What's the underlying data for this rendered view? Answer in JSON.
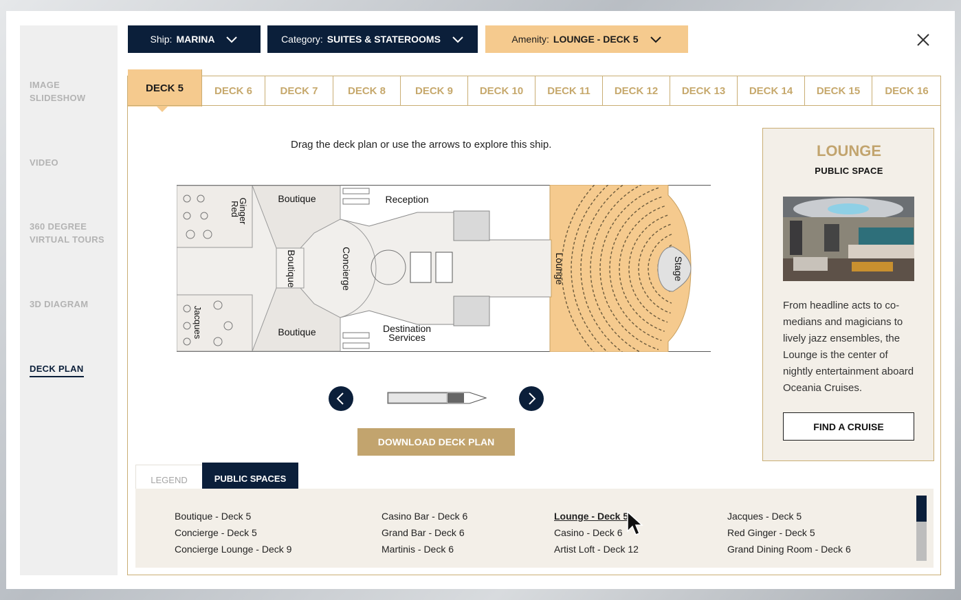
{
  "sidebar": {
    "items": [
      {
        "label": "IMAGE SLIDESHOW"
      },
      {
        "label": "VIDEO"
      },
      {
        "label": "360 DEGREE VIRTUAL TOURS"
      },
      {
        "label": "3D DIAGRAM"
      },
      {
        "label": "DECK PLAN"
      }
    ]
  },
  "filters": {
    "ship": {
      "prefix": "Ship:",
      "value": "MARINA"
    },
    "category": {
      "prefix": "Category:",
      "value": "SUITES & STATEROOMS"
    },
    "amenity": {
      "prefix": "Amenity:",
      "value": "LOUNGE - DECK 5"
    }
  },
  "decks": [
    "DECK 5",
    "DECK 6",
    "DECK 7",
    "DECK 8",
    "DECK 9",
    "DECK 10",
    "DECK 11",
    "DECK 12",
    "DECK 13",
    "DECK 14",
    "DECK 15",
    "DECK 16"
  ],
  "plan": {
    "hint": "Drag the deck plan or use the arrows to explore this ship.",
    "labels": {
      "boutique_top": "Boutique",
      "boutique_mid": "Boutique",
      "boutique_bottom": "Boutique",
      "red": "Red",
      "ginger": "Ginger",
      "jacques": "Jacques",
      "reception": "Reception",
      "concierge": "Concierge",
      "destination": "Destination",
      "services": "Services",
      "lounge": "Lounge",
      "stage": "Stage"
    },
    "download_label": "DOWNLOAD DECK PLAN"
  },
  "card": {
    "title": "LOUNGE",
    "subtitle": "PUBLIC SPACE",
    "description": "From headline acts to co-medians and magicians to lively jazz ensembles, the Lounge is the center of nightly entertainment aboard Oceania Cruises.",
    "button": "FIND A CRUISE"
  },
  "subtabs": {
    "legend": "LEGEND",
    "public_spaces": "PUBLIC SPACES"
  },
  "public_spaces": [
    [
      "Boutique - Deck 5",
      "Concierge - Deck 5",
      "Concierge Lounge - Deck 9"
    ],
    [
      "Casino Bar - Deck 6",
      "Grand Bar - Deck 6",
      "Martinis - Deck 6"
    ],
    [
      "Lounge - Deck 5",
      "Casino - Deck 6",
      "Artist Loft - Deck 12"
    ],
    [
      "Jacques - Deck 5",
      "Red Ginger - Deck 5",
      "Grand Dining Room - Deck 6"
    ]
  ],
  "colors": {
    "navy": "#0b1f3a",
    "gold": "#f5ca8e",
    "tan": "#c2a46e"
  }
}
